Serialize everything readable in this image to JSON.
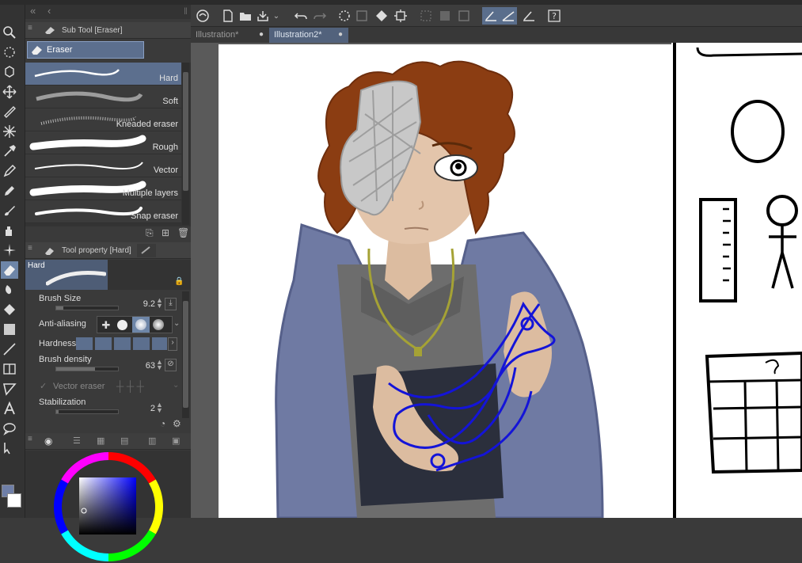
{
  "subtool_panel": {
    "title": "Sub Tool [Eraser]",
    "group": "Eraser",
    "items": [
      {
        "label": "Hard"
      },
      {
        "label": "Soft"
      },
      {
        "label": "Kneaded eraser"
      },
      {
        "label": "Rough"
      },
      {
        "label": "Vector"
      },
      {
        "label": "Multiple layers"
      },
      {
        "label": "Snap eraser"
      }
    ]
  },
  "tool_property": {
    "title": "Tool property [Hard]",
    "preview_label": "Hard",
    "brush_size_label": "Brush Size",
    "brush_size_value": "9.2",
    "anti_aliasing_label": "Anti-aliasing",
    "hardness_label": "Hardness",
    "brush_density_label": "Brush density",
    "brush_density_value": "63",
    "vector_eraser_label": "Vector eraser",
    "stabilization_label": "Stabilization",
    "stabilization_value": "2"
  },
  "document_tabs": [
    {
      "label": "Illustration*",
      "dot": "●"
    },
    {
      "label": "Illustration2*",
      "dot": "●"
    }
  ],
  "colors": {
    "accent": "#5c6f8e",
    "main_color": "#6f7fa8",
    "sub_color": "#ffffff"
  }
}
